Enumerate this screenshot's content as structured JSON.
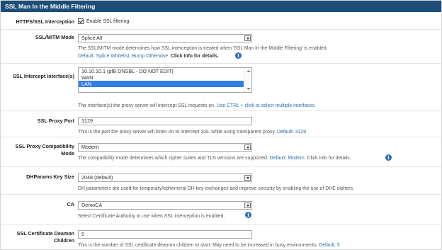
{
  "panel": {
    "title": "SSL Man In the Middle Filtering"
  },
  "https_interception": {
    "label": "HTTPS/SSL Interception",
    "checkbox_label": "Enable SSL filtering.",
    "checked": true
  },
  "ssl_mitm_mode": {
    "label": "SSL/MITM Mode",
    "value": "Splice All",
    "help": "The SSL/MITM mode determines how SSL interception is treated when 'SSL Man In the Middle Filtering' is enabled.",
    "default_text": "Default: Splice Whitelist, Bump Otherwise.",
    "info_text": "Click Info for details.",
    "icon": "info-icon"
  },
  "ssl_intercept_interfaces": {
    "label": "SSL Intercept Interface(s)",
    "options": [
      "10.10.10.1 (pfB DNSBL - DO NOT EDIT)",
      "WAN",
      "LAN"
    ],
    "selected": "LAN",
    "help": "The interface(s) the proxy server will intercept SSL requests on.",
    "help_link": "Use CTRL + click to select multiple interfaces."
  },
  "ssl_proxy_port": {
    "label": "SSL Proxy Port",
    "value": "3129",
    "help": "This is the port the proxy server will listen on to intercept SSL while using transparent proxy.",
    "default_text": "Default: 3129"
  },
  "ssl_proxy_compat": {
    "label_line1": "SSL Proxy Compatibility",
    "label_line2": "Mode",
    "value": "Modern",
    "help": "The compatibility mode determines which cipher suites and TLS versions are supported.",
    "default_text": "Default: Modern.",
    "info_text": "Click Info for details.",
    "icon": "info-icon"
  },
  "dhparams": {
    "label": "DHParams Key Size",
    "value": "2048 (default)",
    "help": "DH parameters are used for temporary/ephemeral DH key exchanges and improve security by enabling the use of DHE ciphers."
  },
  "ca": {
    "label": "CA",
    "value": "DemoCA",
    "help": "Select Certificate Authority to use when SSL interception is enabled.",
    "icon": "info-icon"
  },
  "cert_daemon": {
    "label_line1": "SSL Certificate Deamon",
    "label_line2": "Children",
    "value": "5",
    "help": "This is the number of SSL certificate deamon children to start. May need to be increased in busy environments.",
    "default_text": "Default: 5"
  },
  "colors": {
    "header_bg": "#1d4e7a",
    "link": "#2a6fb0",
    "selected": "#2f80e6"
  }
}
